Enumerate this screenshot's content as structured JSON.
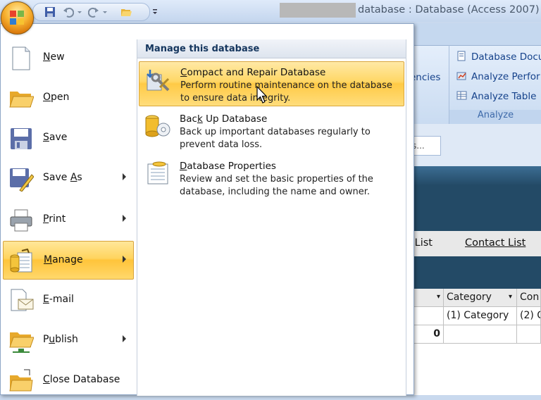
{
  "window": {
    "title": "database : Database (Access 2007)"
  },
  "ribbon": {
    "dependencies_partial": "encies",
    "analyze_items": [
      "Database Docu",
      "Analyze Perfor",
      "Analyze Table"
    ],
    "analyze_group_label": "Analyze",
    "search_placeholder": "s..."
  },
  "tabs": [
    "l List",
    "Contact List"
  ],
  "grid": {
    "headers": [
      "",
      "Category",
      "Con"
    ],
    "row1": [
      "",
      "(1) Category",
      "(2) C"
    ],
    "row2": [
      "0",
      "",
      ""
    ]
  },
  "office_menu": {
    "items": [
      {
        "label": "New",
        "u": "N",
        "rest": "ew",
        "submenu": false
      },
      {
        "label": "Open",
        "u": "O",
        "rest": "pen",
        "submenu": false
      },
      {
        "label": "Save",
        "u": "S",
        "rest": "ave",
        "submenu": false
      },
      {
        "pre": "Save ",
        "u": "A",
        "rest": "s",
        "submenu": true
      },
      {
        "label": "Print",
        "u": "P",
        "rest": "rint",
        "submenu": true
      },
      {
        "label": "Manage",
        "u": "M",
        "rest": "anage",
        "submenu": true,
        "active": true
      },
      {
        "label": "E-mail",
        "u": "E",
        "rest": "-mail",
        "submenu": false
      },
      {
        "pre": "P",
        "u": "u",
        "rest": "blish",
        "submenu": true
      },
      {
        "label": "Close Database",
        "u": "C",
        "rest": "lose Database",
        "submenu": false
      }
    ],
    "submenu_title": "Manage this database",
    "submenu_items": [
      {
        "u": "C",
        "title_rest": "ompact and Repair Database",
        "description": "Perform routine maintenance on the database to ensure data integrity."
      },
      {
        "pre": "Bac",
        "u": "k",
        "title_rest": " Up Database",
        "description": "Back up important databases regularly to prevent data loss."
      },
      {
        "u": "D",
        "title_rest": "atabase Properties",
        "description": "Review and set the basic properties of the database, including the name and owner."
      }
    ]
  },
  "colors": {
    "highlight": "#ffd45e",
    "ribbon_text": "#15428b",
    "dark_band": "#234a66"
  }
}
